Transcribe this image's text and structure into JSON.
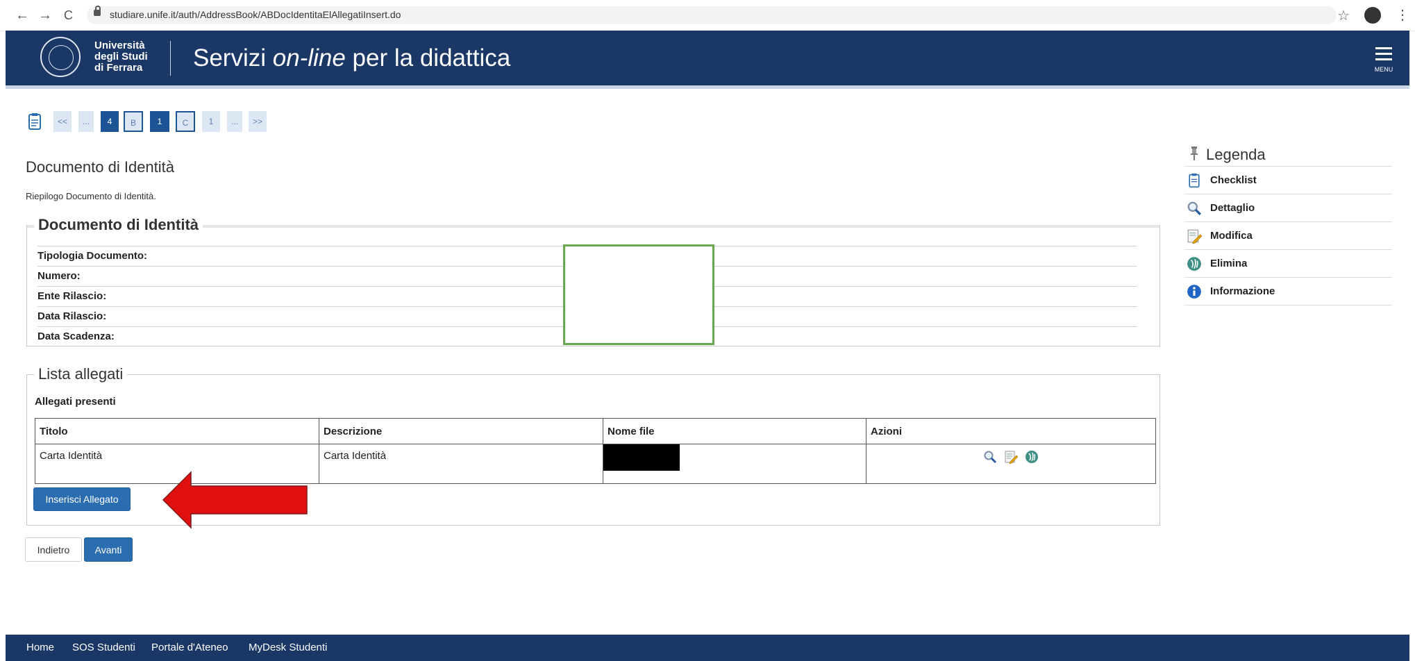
{
  "browser": {
    "url": "studiare.unife.it/auth/AddressBook/ABDocIdentitaElAllegatiInsert.do",
    "back_icon": "←",
    "forward_icon": "→",
    "reload_icon": "C",
    "star_icon": "☆",
    "menu_icon": "⋮"
  },
  "header": {
    "university_line1": "Università",
    "university_line2": "degli Studi",
    "university_line3": "di Ferrara",
    "title_prefix": "Servizi ",
    "title_emph": "on-line",
    "title_suffix": " per la didattica",
    "menu_label": "MENU"
  },
  "pager": {
    "items": [
      "<<",
      "...",
      "4",
      "B",
      "1",
      "C",
      "1",
      "...",
      ">>"
    ]
  },
  "page": {
    "title": "Documento di Identità",
    "summary": "Riepilogo Documento di Identità."
  },
  "document_section": {
    "legend": "Documento di Identità",
    "rows": [
      {
        "label": "Tipologia Documento:"
      },
      {
        "label": "Numero:"
      },
      {
        "label": "Ente Rilascio:"
      },
      {
        "label": "Data Rilascio:"
      },
      {
        "label": "Data Scadenza:"
      }
    ]
  },
  "attachments": {
    "legend": "Lista allegati",
    "subheading": "Allegati presenti",
    "columns": [
      "Titolo",
      "Descrizione",
      "Nome file",
      "Azioni"
    ],
    "rows": [
      {
        "titolo": "Carta Identità",
        "descrizione": "Carta Identità"
      }
    ],
    "insert_button": "Inserisci Allegato"
  },
  "nav_buttons": {
    "back": "Indietro",
    "next": "Avanti"
  },
  "legenda": {
    "title": "Legenda",
    "items": [
      {
        "label": "Checklist",
        "icon": "checklist-icon"
      },
      {
        "label": "Dettaglio",
        "icon": "magnifier-icon"
      },
      {
        "label": "Modifica",
        "icon": "edit-icon"
      },
      {
        "label": "Elimina",
        "icon": "delete-icon"
      },
      {
        "label": "Informazione",
        "icon": "info-icon"
      }
    ]
  },
  "footer": {
    "links": [
      "Home",
      "SOS Studenti",
      "Portale d'Ateneo",
      "MyDesk Studenti"
    ]
  },
  "colors": {
    "brand": "#1a3766",
    "button": "#2a6db0",
    "annotation_arrow": "#e01010",
    "highlight_box": "#6aa84f"
  }
}
